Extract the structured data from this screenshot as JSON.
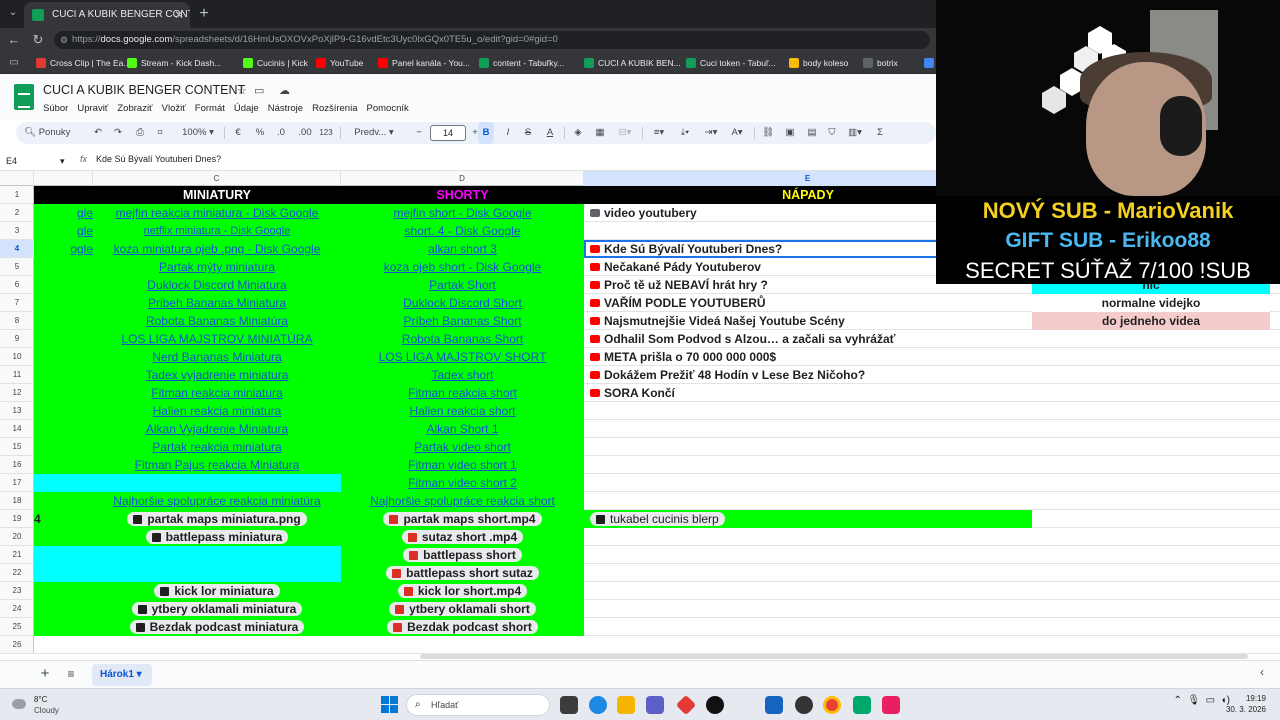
{
  "browser": {
    "tab_title": "CUCI A KUBIK BENGER CONTENT",
    "url_scheme": "https://",
    "url_host": "docs.google.com",
    "url_path": "/spreadsheets/d/16HmUsOXOVxPoXjlP9-G16vdEtc3Uyc0lxGQx0TE5u_o/edit?gid=0#gid=0",
    "bookmarks": [
      {
        "label": "Cross Clip | The Ea...",
        "color": "#e53935"
      },
      {
        "label": "Stream - Kick Dash...",
        "color": "#53fc18"
      },
      {
        "label": "Cucinis | Kick",
        "color": "#53fc18"
      },
      {
        "label": "YouTube",
        "color": "#ff0000"
      },
      {
        "label": "Panel kanála - You...",
        "color": "#ff0000"
      },
      {
        "label": "content - Tabuľky...",
        "color": "#0f9d58"
      },
      {
        "label": "CUCI A KUBIK BEN...",
        "color": "#0f9d58"
      },
      {
        "label": "Cuci token - Tabuľ...",
        "color": "#0f9d58"
      },
      {
        "label": "body koleso",
        "color": "#fbbc04"
      },
      {
        "label": "botrix",
        "color": "#5f6368"
      },
      {
        "label": "Lo",
        "color": "#4285f4"
      }
    ]
  },
  "sheets": {
    "title": "CUCI A KUBIK BENGER CONTENT",
    "menus": [
      "Súbor",
      "Upraviť",
      "Zobraziť",
      "Vložiť",
      "Formát",
      "Údaje",
      "Nástroje",
      "Rozšírenia",
      "Pomocník"
    ],
    "toolbar": {
      "search": "Ponuky",
      "zoom": "100%",
      "currency": "€",
      "percent": "%",
      "dec_less": ".0",
      "dec_more": ".00",
      "number_fmt": "123",
      "font": "Predv...",
      "font_size": "14",
      "bold": "B",
      "italic": "I",
      "strike": "S",
      "text_color": "A",
      "sum": "Σ"
    },
    "name_box": "E4",
    "fx": "fx",
    "formula": "Kde Sú Bývalí Youtuberi Dnes?",
    "sheet_tab": "Hárok1"
  },
  "grid": {
    "col_headers": [
      "C",
      "D",
      "E"
    ],
    "row_numbers": [
      "1",
      "2",
      "3",
      "4",
      "5",
      "6",
      "7",
      "8",
      "9",
      "10",
      "11",
      "12",
      "13",
      "14",
      "15",
      "16",
      "17",
      "18",
      "19",
      "20",
      "21",
      "22",
      "23",
      "24",
      "25",
      "26"
    ],
    "headers": {
      "miniatury": "MINIATURY",
      "shorty": "SHORTY",
      "napady": "NÁPADY"
    },
    "colB_partial": {
      "r2": "gle",
      "r3": "gle",
      "r4": "ogle",
      "r19": "4"
    },
    "miniatury": [
      "mejfin reakcia miniatura - Disk Google",
      "netflix miniatura - Disk Google",
      "koza miniatura ojeb .png - Disk Google",
      "Partak mýty miniatura",
      "Duklock Discord Miniatura",
      "Pribeh Bananas Miniatura",
      "Robota Bananas Miniatúra",
      "LOS LIGA MAJSTROV MINIATÚRA",
      "Nerd Bananas Miniatura",
      "Tadex vyjadrenie miniatura",
      "Fitman reakcia miniatura",
      "Halien reakcia miniatura",
      "Alkan Vyjadrenie Miniatura",
      "Partak reakcia miniatura",
      "Fitman Pajus reakcia Miniatura",
      "",
      "Najhoršie spolupráce reakcia miniatúra"
    ],
    "miniatury_files": [
      {
        "row": 19,
        "label": "partak maps miniatura.png"
      },
      {
        "row": 20,
        "label": "battlepass miniatura"
      },
      {
        "row": 23,
        "label": "kick lor miniatura"
      },
      {
        "row": 24,
        "label": "ytbery oklamali miniatura"
      },
      {
        "row": 25,
        "label": "Bezdak podcast miniatura"
      }
    ],
    "shorty": [
      "mejfin short - Disk Google",
      "short. 4 - Disk Google",
      "alkan short 3",
      "koza ojeb short - Disk Google",
      "Partak Short",
      "Duklock Discord Short",
      "Príbeh Bananas Short",
      "Robota Bananas Short",
      "LOS LIGA MAJSTROV SHORT",
      "Tadex short",
      "Fitman reakcia short",
      "Halien reakcia short",
      "Alkan Short 1",
      "Partak video short",
      "Fitman video short 1",
      "Fitman video short 2",
      "Najhoršie spolupráce reakcia short"
    ],
    "shorty_files": [
      {
        "row": 19,
        "label": "partak maps short.mp4"
      },
      {
        "row": 20,
        "label": "sutaz short .mp4"
      },
      {
        "row": 21,
        "label": "battlepass short"
      },
      {
        "row": 22,
        "label": "battlepass short sutaz"
      },
      {
        "row": 23,
        "label": "kick lor short.mp4"
      },
      {
        "row": 24,
        "label": "ytbery oklamali short"
      },
      {
        "row": 25,
        "label": "Bezdak podcast short"
      }
    ],
    "napady": [
      {
        "row": 2,
        "label": "video youtubery",
        "icon": "gray"
      },
      {
        "row": 4,
        "label": "Kde Sú Bývalí Youtuberi Dnes?",
        "icon": "yt"
      },
      {
        "row": 5,
        "label": "Nečakané Pády Youtuberov",
        "icon": "yt"
      },
      {
        "row": 6,
        "label": "Proč tě už NEBAVÍ hrát hry ?",
        "icon": "yt"
      },
      {
        "row": 7,
        "label": "VAŘÍM PODLE YOUTUBERŮ",
        "icon": "yt"
      },
      {
        "row": 8,
        "label": "Najsmutnejšie Videá Našej Youtube Scény",
        "icon": "yt"
      },
      {
        "row": 9,
        "label": "Odhalil Som Podvod s Alzou… a začali sa vyhrážať",
        "icon": "yt"
      },
      {
        "row": 10,
        "label": "META prišla o 70 000 000 000$",
        "icon": "yt"
      },
      {
        "row": 11,
        "label": "Dokážem Prežiť 48 Hodín v Lese Bez Ničoho?",
        "icon": "yt"
      },
      {
        "row": 12,
        "label": "SORA Končí",
        "icon": "yt"
      }
    ],
    "napady_file": {
      "row": 19,
      "label": "tukabel cucinis blerp"
    },
    "colF": [
      {
        "row": 6,
        "label": "nic"
      },
      {
        "row": 7,
        "label": "normalne videjko"
      },
      {
        "row": 8,
        "label": "do jedneho videa"
      }
    ]
  },
  "overlay": {
    "new_sub": "NOVÝ SUB - MarioVanik",
    "gift_sub": "GIFT SUB - Erikoo88",
    "secret": "SECRET SÚŤAŽ  7/100 !SUB"
  },
  "taskbar": {
    "temp": "8°C",
    "weather": "Cloudy",
    "search": "Hľadať",
    "time": "19:19",
    "date": "30. 3. 2026"
  },
  "colors": {
    "green_fill": "#00ff00",
    "cyan_fill": "#00ffff",
    "header_bg": "#000000",
    "miniatury_header": "#ffffff",
    "shorty_header": "#ff00ff",
    "napady_header": "#ffff00",
    "link": "#1155cc"
  }
}
